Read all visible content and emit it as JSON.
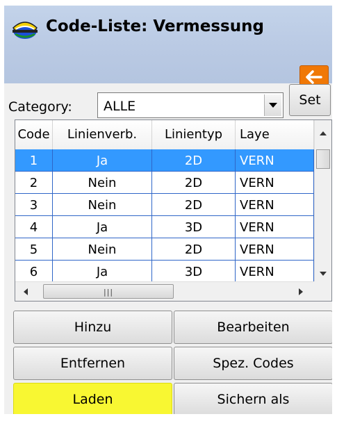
{
  "header": {
    "title": "Code-Liste: Vermessung",
    "back_icon": "arrow-left-icon",
    "accent": "#f07806"
  },
  "category": {
    "label": "Category:",
    "value": "ALLE",
    "set_label": "Set"
  },
  "table": {
    "columns": [
      "Code",
      "Linienverb.",
      "Linientyp",
      "Laye"
    ],
    "rows": [
      [
        "1",
        "Ja",
        "2D",
        "VERN"
      ],
      [
        "2",
        "Nein",
        "2D",
        "VERN"
      ],
      [
        "3",
        "Nein",
        "2D",
        "VERN"
      ],
      [
        "4",
        "Ja",
        "3D",
        "VERN"
      ],
      [
        "5",
        "Nein",
        "2D",
        "VERN"
      ],
      [
        "6",
        "Ja",
        "3D",
        "VERN"
      ]
    ],
    "selected_row": 0,
    "selection_color": "#3399ff"
  },
  "buttons": {
    "add": "Hinzu",
    "edit": "Bearbeiten",
    "remove": "Entfernen",
    "special": "Spez. Codes",
    "load": "Laden",
    "save_as": "Sichern als",
    "highlight_color": "#f8f732"
  }
}
